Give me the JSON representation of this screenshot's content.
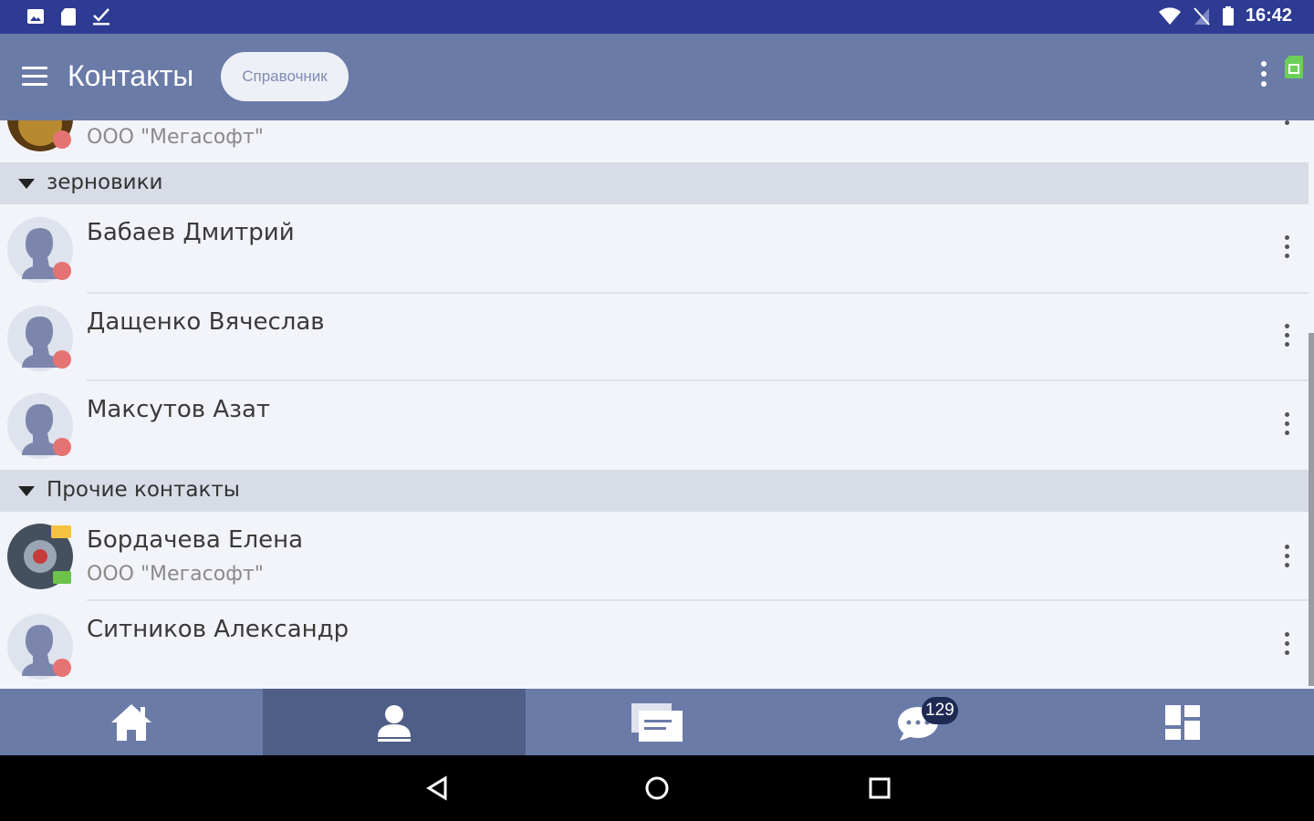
{
  "status_bar": {
    "time": "16:42",
    "left_icons": [
      "image-icon",
      "sd-card-icon",
      "check-download-icon"
    ],
    "right_icons": [
      "wifi-icon",
      "no-signal-icon",
      "battery-icon"
    ]
  },
  "app_bar": {
    "title": "Контакты",
    "chip_label": "Справочник",
    "icons": [
      "menu-icon",
      "more-vert-icon",
      "sim-card-icon"
    ]
  },
  "contacts": {
    "partial_top": {
      "org": "ООО \"Мегасофт\"",
      "status": "busy"
    },
    "groups": [
      {
        "label": "зерновики",
        "items": [
          {
            "name": "Бабаев Дмитрий",
            "org": "",
            "status": "busy"
          },
          {
            "name": "Дащенко Вячеслав",
            "org": "",
            "status": "busy"
          },
          {
            "name": "Максутов Азат",
            "org": "",
            "status": "busy"
          }
        ]
      },
      {
        "label": "Прочие контакты",
        "items": [
          {
            "name": "Бордачева Елена",
            "org": "ООО \"Мегасофт\"",
            "status": "online"
          },
          {
            "name": "Ситников Александр",
            "org": "",
            "status": "busy"
          }
        ]
      }
    ]
  },
  "bottom_nav": {
    "items": [
      "home-icon",
      "contacts-icon",
      "feed-icon",
      "chat-icon",
      "apps-icon"
    ],
    "active_index": 1,
    "chat_badge": "129"
  },
  "colors": {
    "status_bar": "#2e3b93",
    "app_bar": "#6b7ba8",
    "nav_active": "#4f5e86",
    "busy": "#e57373",
    "online": "#6cc24a"
  }
}
